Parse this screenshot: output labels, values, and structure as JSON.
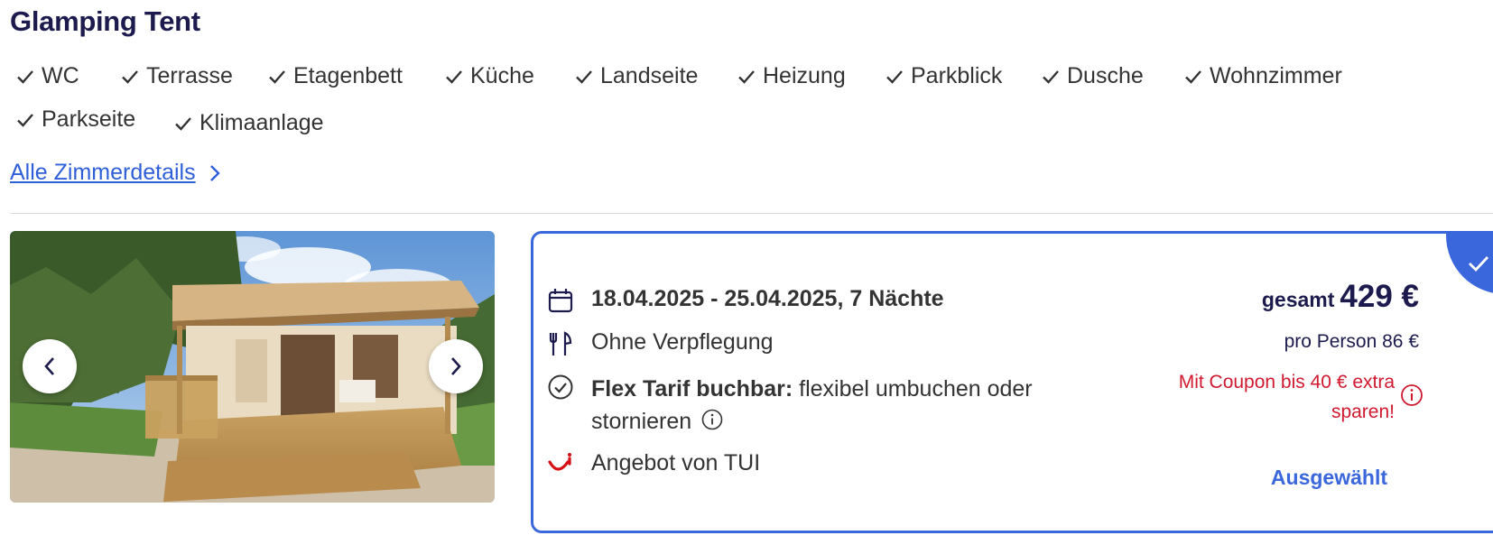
{
  "room": {
    "title": "Glamping Tent",
    "amenities": [
      "WC",
      "Terrasse",
      "Etagenbett",
      "Küche",
      "Landseite",
      "Heizung",
      "Parkblick",
      "Dusche",
      "Wohnzimmer",
      "Parkseite",
      "Klimaanlage"
    ],
    "details_link": "Alle Zimmerdetails"
  },
  "offer": {
    "dates": "18.04.2025 - 25.04.2025, 7 Nächte",
    "board": "Ohne Verpflegung",
    "flex_bold": "Flex Tarif buchbar:",
    "flex_rest": "flexibel umbuchen oder",
    "flex_line2": "stornieren",
    "provider": "Angebot von TUI",
    "total_label": "gesamt",
    "total_price": "429 €",
    "per_person": "pro Person 86 €",
    "coupon": "Mit Coupon bis 40 € extra sparen!",
    "selected_label": "Ausgewählt"
  },
  "colors": {
    "title": "#1d1b4e",
    "accent_blue": "#3b67dd",
    "link": "#2f5fd8",
    "coupon_red": "#d0192f",
    "tui_red": "#d40e14"
  },
  "icons": {
    "amenity": "check-icon",
    "dates": "calendar-icon",
    "board": "fork-knife-icon",
    "flex": "check-circle-icon",
    "provider": "tui-smile-icon",
    "info": "info-icon",
    "gallery_prev": "chevron-left-icon",
    "gallery_next": "chevron-right-icon",
    "selected": "check-icon"
  }
}
